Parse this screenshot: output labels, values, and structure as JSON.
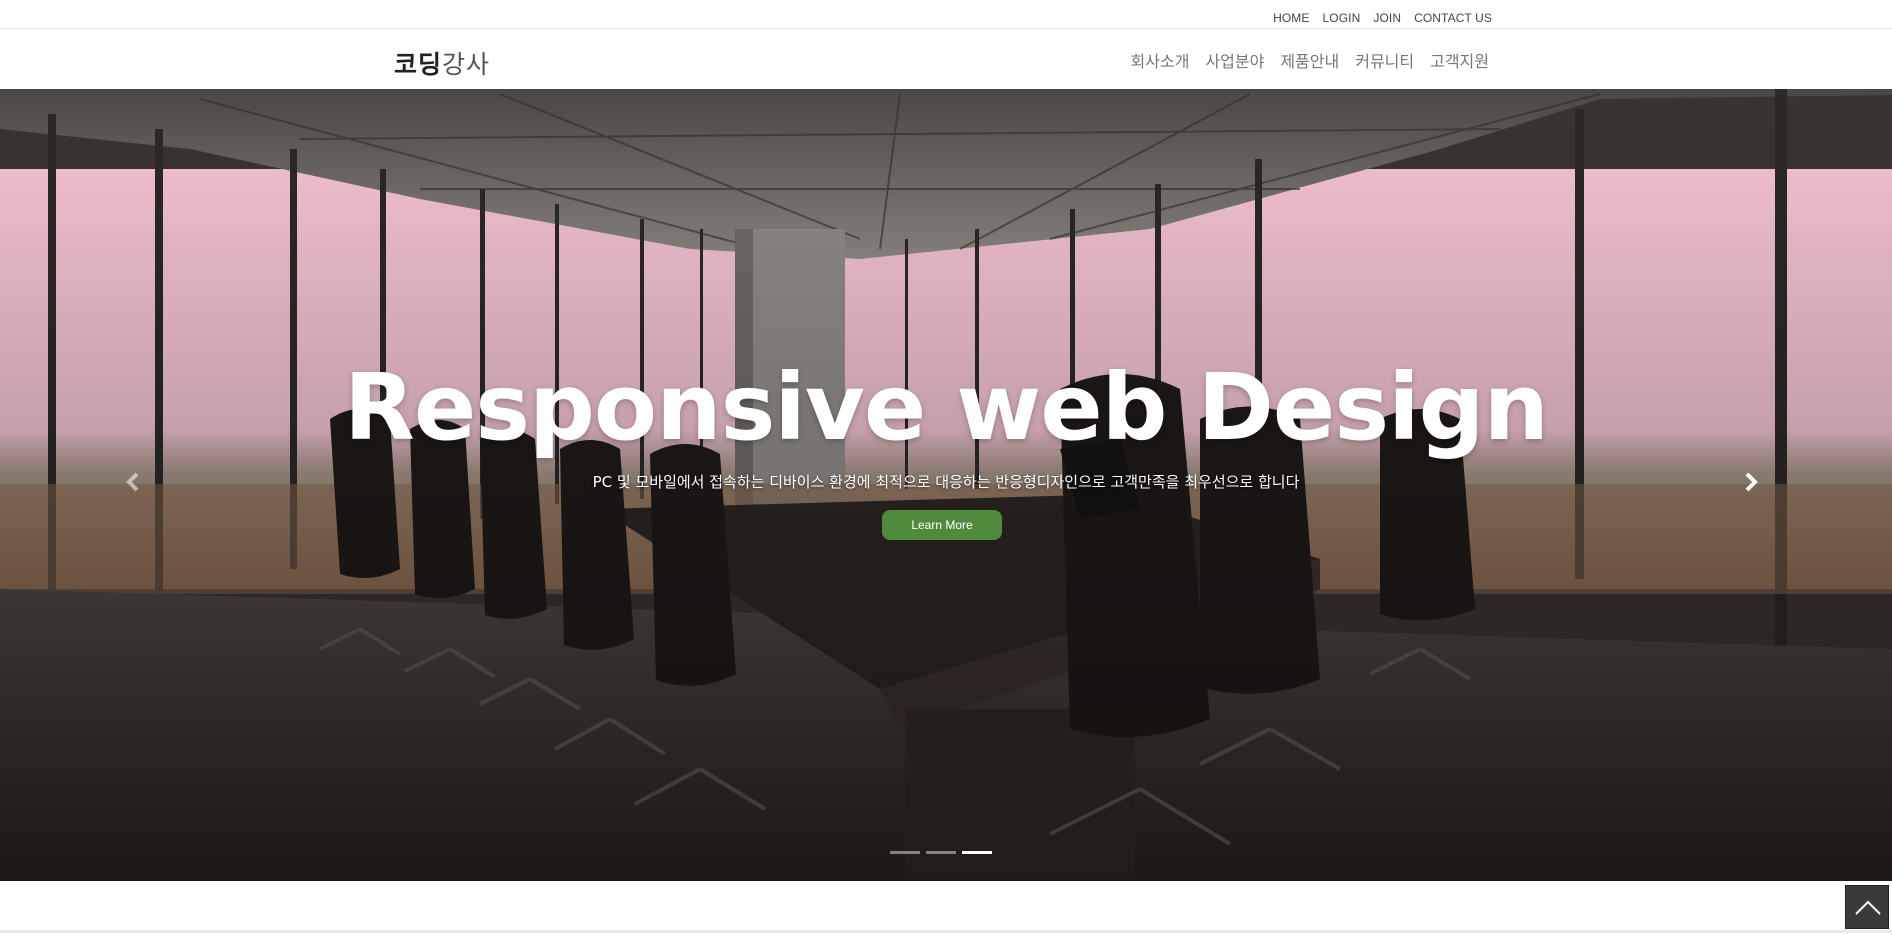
{
  "topbar": {
    "links": [
      "HOME",
      "LOGIN",
      "JOIN",
      "CONTACT US"
    ]
  },
  "header": {
    "logo_main": "코딩",
    "logo_accent": "강사",
    "nav": [
      "회사소개",
      "사업분야",
      "제품안내",
      "커뮤니티",
      "고객지원"
    ]
  },
  "hero": {
    "title": "Responsive web Design",
    "subtitle": "PC 및 모바일에서 접속하는 디바이스 환경에 최적으로 대응하는 반응형디자인으로 고객만족을 최우선으로 합니다",
    "button_label": "Learn More",
    "slide_count": 3,
    "active_slide": 3
  },
  "colors": {
    "button": "#4f8a3d",
    "window_tint": "#f2bfd0",
    "floor": "#3a3430"
  },
  "icons": {
    "prev": "chevron-left-icon",
    "next": "chevron-right-icon",
    "top": "chevron-up-icon"
  }
}
